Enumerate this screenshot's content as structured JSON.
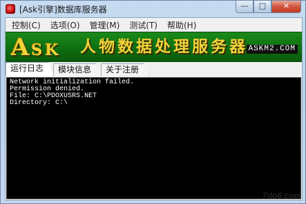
{
  "window": {
    "title": "[Ask引擎]数据库服务器",
    "minimize_glyph": "—",
    "maximize_glyph": "□",
    "close_glyph": "✕"
  },
  "menu": [
    {
      "label": "控制(C)"
    },
    {
      "label": "选项(O)"
    },
    {
      "label": "管理(M)"
    },
    {
      "label": "测试(T)"
    },
    {
      "label": "帮助(H)"
    }
  ],
  "banner": {
    "logo_initial": "A",
    "logo_rest": "SK",
    "title": "人物数据处理服务器",
    "watermark": "ASKM2.COM",
    "colors": {
      "background": "#0e6f10",
      "text": "#f0d23a"
    }
  },
  "tabs": [
    {
      "label": "运行日志",
      "active": true
    },
    {
      "label": "模块信息",
      "active": false
    },
    {
      "label": "关于注册",
      "active": false
    }
  ],
  "console": {
    "lines": [
      "Network initialization failed.",
      "Permission denied.",
      "File: C:\\PDOXUSRS.NET",
      "Directory: C:\\"
    ]
  },
  "footer": {
    "watermark": "7do6.com"
  }
}
